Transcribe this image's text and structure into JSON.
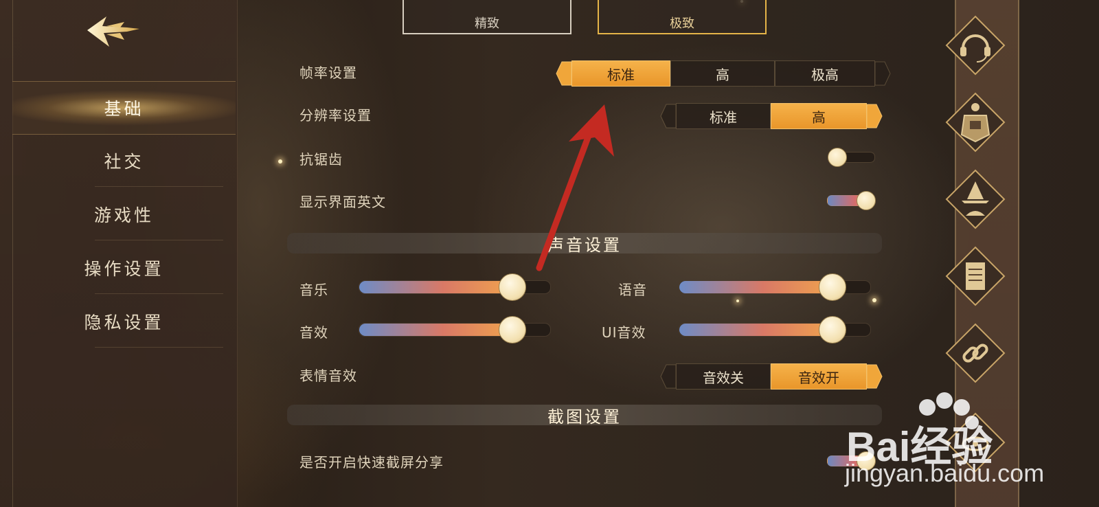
{
  "nav": {
    "items": [
      {
        "label": "基础"
      },
      {
        "label": "社交"
      },
      {
        "label": "游戏性"
      },
      {
        "label": "操作设置"
      },
      {
        "label": "隐私设置"
      }
    ]
  },
  "quality": {
    "option_1": "精致",
    "option_2": "极致"
  },
  "settings": {
    "frame_rate": {
      "label": "帧率设置",
      "options": [
        "标准",
        "高",
        "极高"
      ],
      "selected": "标准"
    },
    "resolution": {
      "label": "分辨率设置",
      "options": [
        "标准",
        "高"
      ],
      "selected": "高"
    },
    "anti_alias": {
      "label": "抗锯齿",
      "on": false
    },
    "show_english": {
      "label": "显示界面英文",
      "on": true
    }
  },
  "audio": {
    "title": "声音设置",
    "music": {
      "label": "音乐",
      "value": 0.8
    },
    "voice": {
      "label": "语音",
      "value": 0.8
    },
    "sfx": {
      "label": "音效",
      "value": 0.8
    },
    "ui_sfx": {
      "label": "UI音效",
      "value": 0.8
    },
    "emote_sfx": {
      "label": "表情音效",
      "options": [
        "音效关",
        "音效开"
      ],
      "selected": "音效开"
    }
  },
  "screenshot": {
    "title": "截图设置",
    "quick_share": {
      "label": "是否开启快速截屏分享",
      "on": true
    }
  },
  "watermark": {
    "text1": "Bai经验",
    "text2": "jingyan.baidu.com"
  },
  "colors": {
    "accent": "#f0a63a",
    "annotation_arrow": "#c42a22"
  }
}
